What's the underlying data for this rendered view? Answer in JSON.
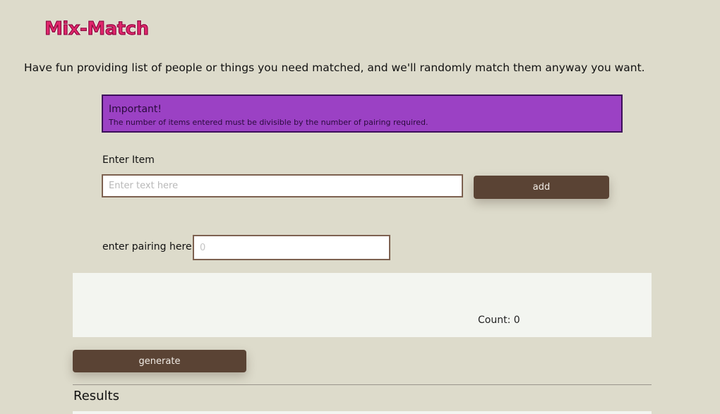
{
  "header": {
    "logo_text": "Mix-Match",
    "tagline": "Have fun providing list of people or things you need matched, and we'll randomly match them anyway you want."
  },
  "notice": {
    "title": "Important!",
    "text": "The number of items entered must be divisible by the number of pairing required."
  },
  "item_entry": {
    "label": "Enter Item",
    "placeholder": "Enter text here",
    "value": "",
    "add_label": "add"
  },
  "pairing": {
    "label": "enter pairing here",
    "placeholder": "0",
    "value": ""
  },
  "list": {
    "count_text": "Count: 0"
  },
  "actions": {
    "generate_label": "generate"
  },
  "results": {
    "title": "Results"
  },
  "colors": {
    "background": "#dddbcb",
    "logo": "#e0256d",
    "notice_bg": "#9b41c4",
    "button_bg": "#5a4334",
    "panel_bg": "#f3f5f0"
  }
}
